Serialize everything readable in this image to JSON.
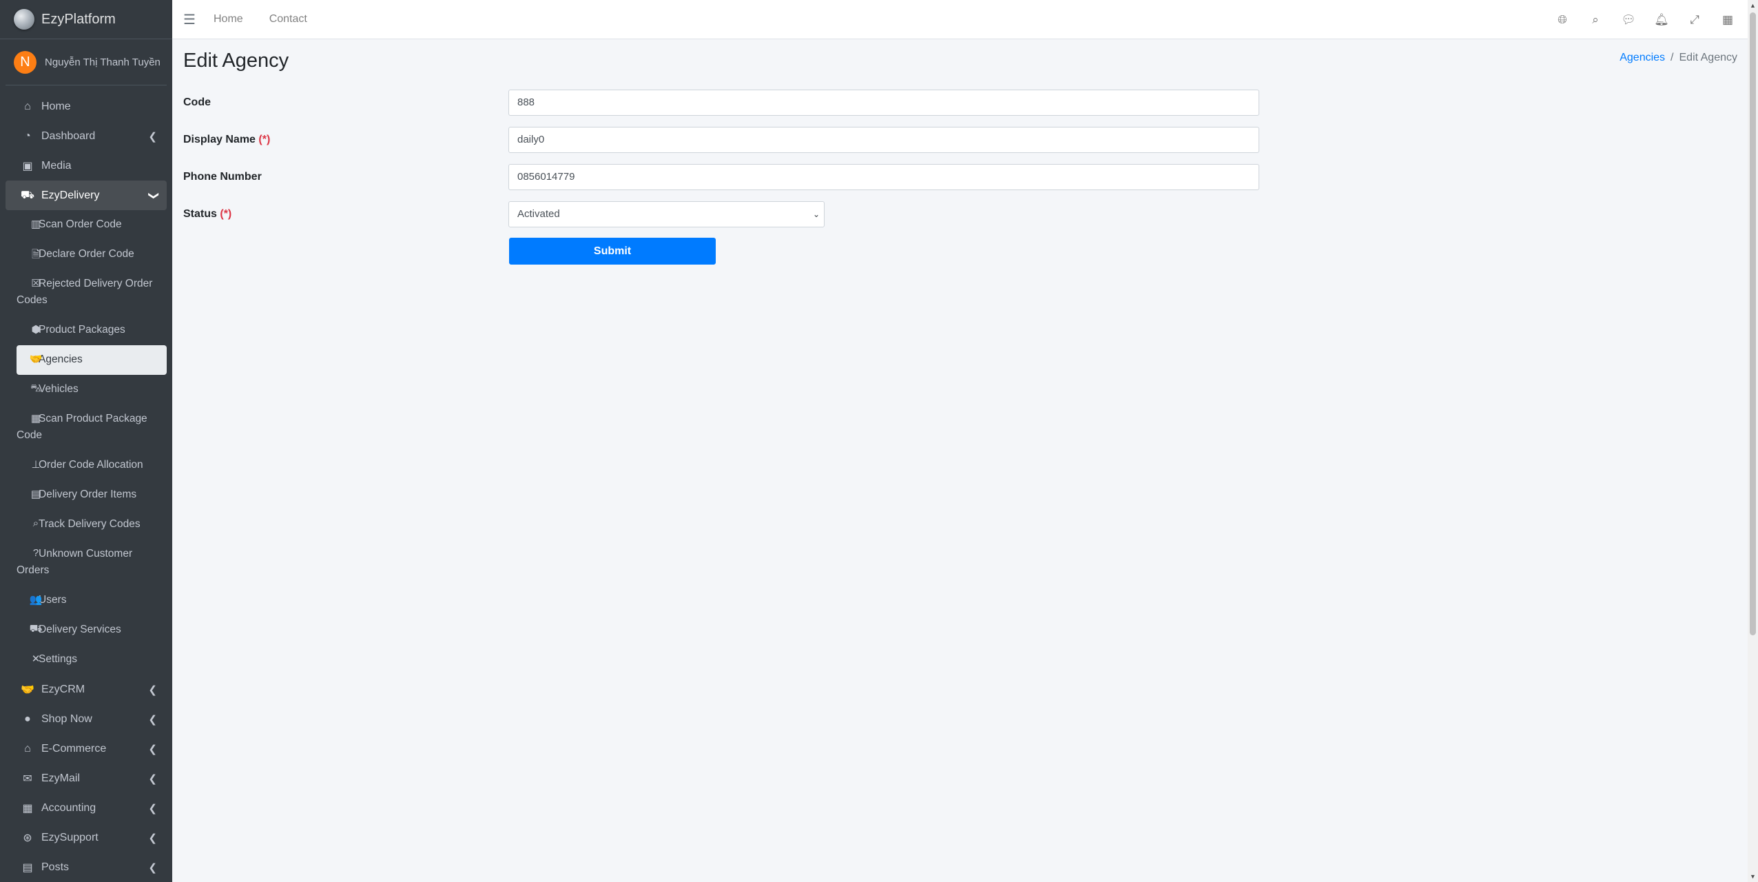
{
  "brand": {
    "name": "EzyPlatform"
  },
  "user": {
    "initial": "N",
    "name": "Nguyễn Thị Thanh Tuyền"
  },
  "sidebar": {
    "top_items_before": [
      {
        "label": "Home",
        "icon": "home-icon"
      },
      {
        "label": "Dashboard",
        "icon": "dashboard-icon",
        "has_children": true
      },
      {
        "label": "Media",
        "icon": "image-icon"
      }
    ],
    "open_item": {
      "label": "EzyDelivery",
      "icon": "truck-icon"
    },
    "sub_items": [
      {
        "label": "Scan Order Code",
        "icon": "barcode-icon"
      },
      {
        "label": "Declare Order Code",
        "icon": "file-icon"
      },
      {
        "label": "Rejected Delivery Order Codes",
        "icon": "x-square-icon"
      },
      {
        "label": "Product Packages",
        "icon": "cubes-icon"
      },
      {
        "label": "Agencies",
        "icon": "handshake-icon",
        "active": true
      },
      {
        "label": "Vehicles",
        "icon": "car-icon"
      },
      {
        "label": "Scan Product Package Code",
        "icon": "qrcode-icon"
      },
      {
        "label": "Order Code Allocation",
        "icon": "sitemap-icon"
      },
      {
        "label": "Delivery Order Items",
        "icon": "table-icon"
      },
      {
        "label": "Track Delivery Codes",
        "icon": "search-icon"
      },
      {
        "label": "Unknown Customer Orders",
        "icon": "question-icon"
      },
      {
        "label": "Users",
        "icon": "users-icon"
      },
      {
        "label": "Delivery Services",
        "icon": "truck-icon"
      },
      {
        "label": "Settings",
        "icon": "tools-icon"
      }
    ],
    "top_items_after": [
      {
        "label": "EzyCRM",
        "icon": "handshake-icon"
      },
      {
        "label": "Shop Now",
        "icon": "circle-icon"
      },
      {
        "label": "E-Commerce",
        "icon": "basket-icon"
      },
      {
        "label": "EzyMail",
        "icon": "envelope-icon"
      },
      {
        "label": "Accounting",
        "icon": "calculator-icon"
      },
      {
        "label": "EzySupport",
        "icon": "lifering-icon"
      },
      {
        "label": "Posts",
        "icon": "newspaper-icon"
      }
    ]
  },
  "navbar": {
    "links": [
      "Home",
      "Contact"
    ]
  },
  "page": {
    "title": "Edit Agency",
    "breadcrumb": {
      "parent": "Agencies",
      "separator": "/",
      "current": "Edit Agency"
    }
  },
  "form": {
    "code_label": "Code",
    "code_value": "888",
    "display_name_label": "Display Name",
    "display_name_value": "daily0",
    "phone_label": "Phone Number",
    "phone_value": "0856014779",
    "status_label": "Status",
    "status_value": "Activated",
    "required_mark": "(*)",
    "submit_label": "Submit"
  },
  "colors": {
    "sidebar_bg": "#343a40",
    "primary": "#007bff",
    "required": "#dc3545",
    "avatar": "#fd7e14"
  }
}
